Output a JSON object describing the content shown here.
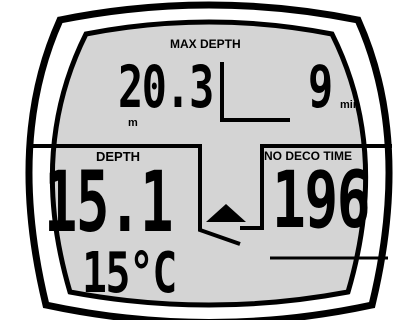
{
  "display": {
    "max_depth_label": "MAX DEPTH",
    "max_depth_value": "20.3",
    "max_depth_unit": "m",
    "dive_time_value": "9",
    "dive_time_unit": "min",
    "depth_label": "DEPTH",
    "depth_value": "15.1",
    "no_deco_label": "NO DECO TIME",
    "no_deco_value": "196",
    "ascent_indicator": "up-arrow-icon",
    "temperature_value": "15°C"
  },
  "colors": {
    "lcd_background": "#d4d4d4",
    "bezel": "#000000",
    "segments": "#000000"
  }
}
